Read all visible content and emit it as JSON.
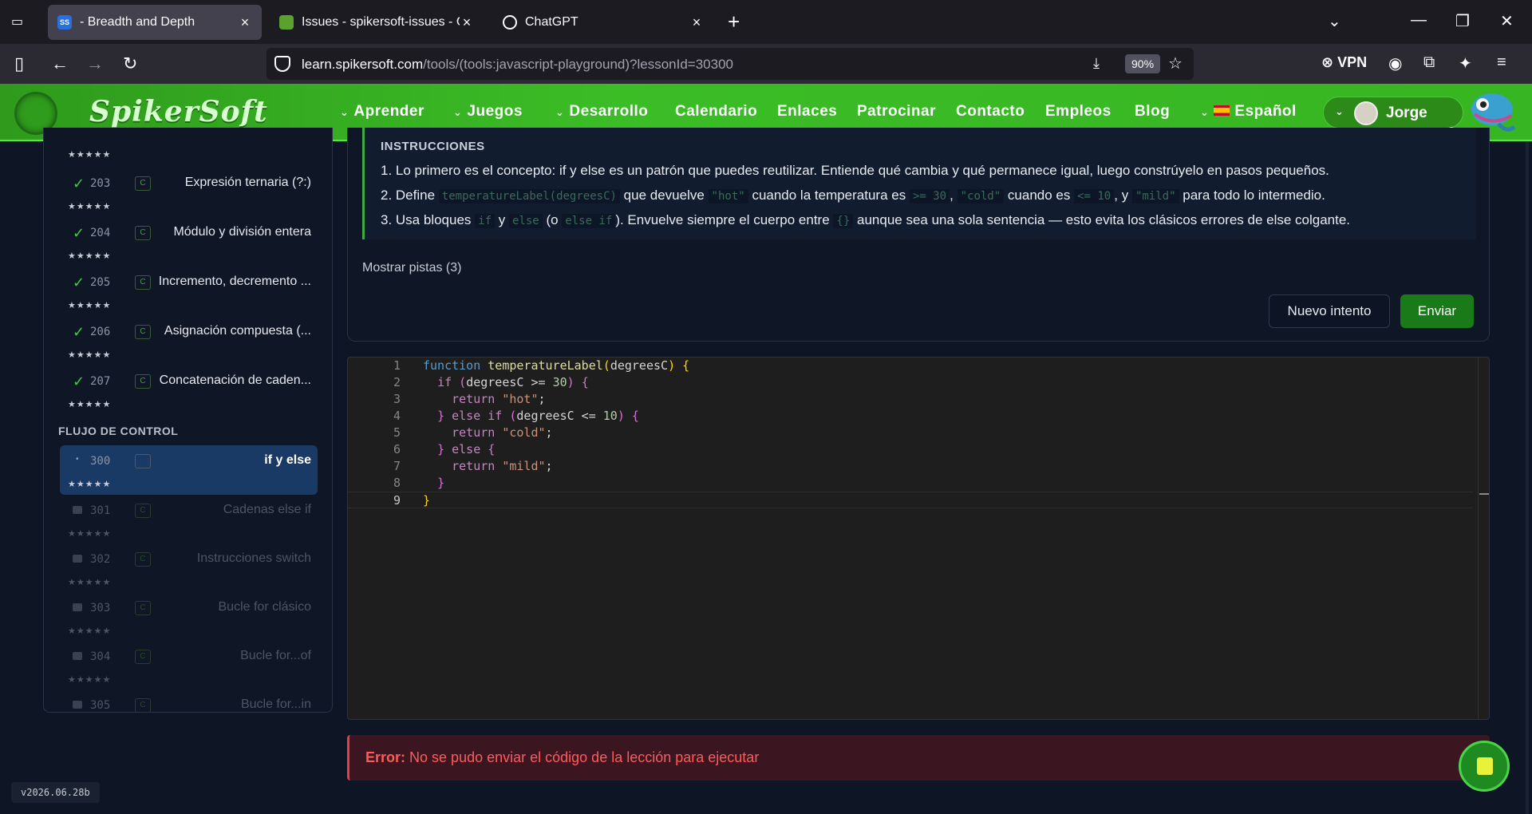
{
  "browser": {
    "tabs": [
      {
        "label": "- Breadth and Depth",
        "favicon": "SS"
      },
      {
        "label": "Issues - spikersoft-issues - Gitea",
        "favicon": ""
      },
      {
        "label": "ChatGPT",
        "favicon": ""
      }
    ],
    "url_domain": "learn.spikersoft.com",
    "url_path": "/tools/(tools:javascript-playground)?lessonId=30300",
    "zoom": "90%",
    "vpn_label": "VPN"
  },
  "site": {
    "brand": "SpikerSoft",
    "menu": [
      {
        "label": "Aprender",
        "has_dropdown": true
      },
      {
        "label": "Juegos",
        "has_dropdown": true
      },
      {
        "label": "Desarrollo",
        "has_dropdown": true
      },
      {
        "label": "Calendario",
        "has_dropdown": false
      },
      {
        "label": "Enlaces",
        "has_dropdown": false
      },
      {
        "label": "Patrocinar",
        "has_dropdown": false
      },
      {
        "label": "Contacto",
        "has_dropdown": false
      },
      {
        "label": "Empleos",
        "has_dropdown": false
      },
      {
        "label": "Blog",
        "has_dropdown": false
      }
    ],
    "language": "Español",
    "user": "Jorge"
  },
  "sidebar": {
    "stars": "★★★★★",
    "section_control": "FLUJO DE CONTROL",
    "lessons": [
      {
        "num": "203",
        "title": "Expresión ternaria (?:)",
        "state": "done"
      },
      {
        "num": "204",
        "title": "Módulo y división entera",
        "state": "done"
      },
      {
        "num": "205",
        "title": "Incremento, decremento ...",
        "state": "done"
      },
      {
        "num": "206",
        "title": "Asignación compuesta (...",
        "state": "done"
      },
      {
        "num": "207",
        "title": "Concatenación de caden...",
        "state": "done"
      },
      {
        "num": "300",
        "title": "if y else",
        "state": "active"
      },
      {
        "num": "301",
        "title": "Cadenas else if",
        "state": "locked"
      },
      {
        "num": "302",
        "title": "Instrucciones switch",
        "state": "locked"
      },
      {
        "num": "303",
        "title": "Bucle for clásico",
        "state": "locked"
      },
      {
        "num": "304",
        "title": "Bucle for...of",
        "state": "locked"
      },
      {
        "num": "305",
        "title": "Bucle for...in",
        "state": "locked"
      }
    ]
  },
  "instructions": {
    "heading": "INSTRUCCIONES",
    "step1": "Lo primero es el concepto: if y else es un patrón que puedes reutilizar. Entiende qué cambia y qué permanece igual, luego constrúyelo en pasos pequeños.",
    "step2": {
      "a": "Define",
      "code1": "temperatureLabel(degreesC)",
      "b": "que devuelve",
      "code2": "\"hot\"",
      "c": "cuando la temperatura es",
      "code3": ">= 30",
      "d": ",",
      "code4": "\"cold\"",
      "e": "cuando es",
      "code5": "<= 10",
      "f": ", y",
      "code6": "\"mild\"",
      "g": "para todo lo intermedio."
    },
    "step3": {
      "a": "Usa bloques",
      "code1": "if",
      "b": "y",
      "code2": "else",
      "c": "(o",
      "code3": "else if",
      "d": "). Envuelve siempre el cuerpo entre",
      "code4": "{}",
      "e": "aunque sea una sola sentencia — esto evita los clásicos errores de else colgante."
    },
    "hints": "Mostrar pistas (3)",
    "retry_button": "Nuevo intento",
    "submit_button": "Enviar"
  },
  "editor": {
    "line_numbers": [
      "1",
      "2",
      "3",
      "4",
      "5",
      "6",
      "7",
      "8",
      "9"
    ]
  },
  "error": {
    "label": "Error:",
    "message": "No se pudo enviar el código de la lección para ejecutar"
  },
  "version": "v2026.06.28b"
}
